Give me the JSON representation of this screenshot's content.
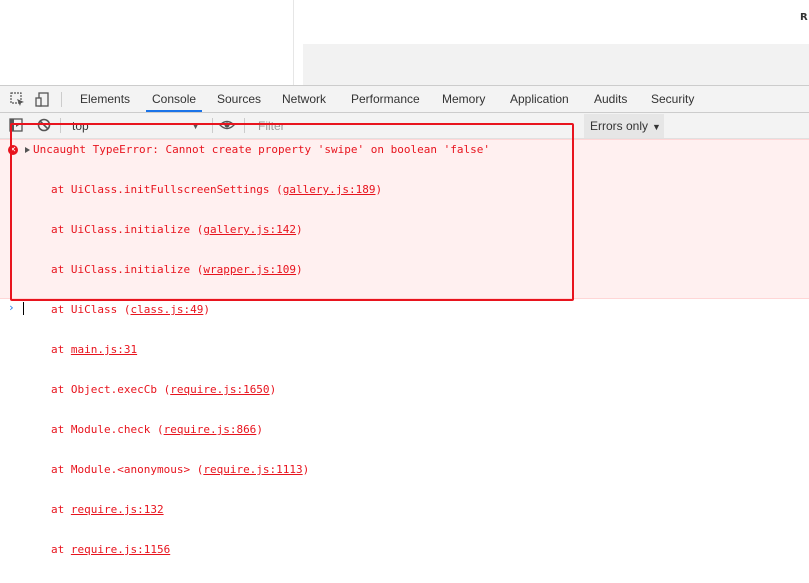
{
  "page": {
    "corner_text": "R"
  },
  "devtools": {
    "tabs": [
      {
        "label": "Elements"
      },
      {
        "label": "Console",
        "active": true
      },
      {
        "label": "Sources"
      },
      {
        "label": "Network"
      },
      {
        "label": "Performance"
      },
      {
        "label": "Memory"
      },
      {
        "label": "Application"
      },
      {
        "label": "Audits"
      },
      {
        "label": "Security"
      }
    ],
    "icons": [
      "inspect-element-icon",
      "device-toolbar-icon",
      "sidebar-toggle-icon",
      "clear-console-icon",
      "live-expression-eye-icon"
    ],
    "accent_color": "#1a73e8"
  },
  "toolbar": {
    "context": "top",
    "filter_placeholder": "Filter",
    "levels": "Errors only"
  },
  "error": {
    "color": "#e8141e",
    "message": "Uncaught TypeError: Cannot create property 'swipe' on boolean 'false'",
    "stack": [
      {
        "prefix": "at UiClass.initFullscreenSettings (",
        "link": "gallery.js:189",
        "suffix": ")"
      },
      {
        "prefix": "at UiClass.initialize (",
        "link": "gallery.js:142",
        "suffix": ")"
      },
      {
        "prefix": "at UiClass.initialize (",
        "link": "wrapper.js:109",
        "suffix": ")"
      },
      {
        "prefix": "at UiClass (",
        "link": "class.js:49",
        "suffix": ")"
      },
      {
        "prefix": "at ",
        "link": "main.js:31",
        "suffix": ""
      },
      {
        "prefix": "at Object.execCb (",
        "link": "require.js:1650",
        "suffix": ")"
      },
      {
        "prefix": "at Module.check (",
        "link": "require.js:866",
        "suffix": ")"
      },
      {
        "prefix": "at Module.<anonymous> (",
        "link": "require.js:1113",
        "suffix": ")"
      },
      {
        "prefix": "at ",
        "link": "require.js:132",
        "suffix": ""
      },
      {
        "prefix": "at ",
        "link": "require.js:1156",
        "suffix": ""
      }
    ]
  },
  "prompt": {
    "glyph": "›"
  }
}
